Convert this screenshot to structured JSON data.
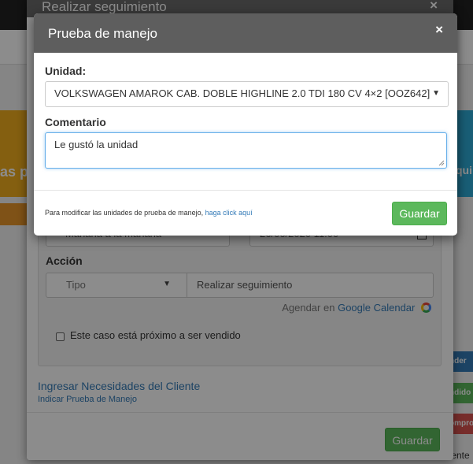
{
  "background": {
    "card_left_text": "as p",
    "card_right_text": "qui",
    "side_buttons": [
      "nder",
      "ndido",
      "ompro"
    ],
    "cliente_text": "liente"
  },
  "modal_seguimiento": {
    "title": "Realizar seguimiento",
    "close": "×",
    "schedule_select": "Mañana a la mañana",
    "schedule_date": "26/06/2020  11:00",
    "accion_label": "Acción",
    "tipo_placeholder": "Tipo",
    "accion_value": "Realizar seguimiento",
    "agendar_prefix": "Agendar en",
    "agendar_link": "Google Calendar",
    "checkbox_label": "Este caso está próximo a ser vendido",
    "link_necesidades": "Ingresar Necesidades del Cliente",
    "link_prueba": "Indicar Prueba de Manejo",
    "guardar": "Guardar"
  },
  "modal_prueba": {
    "title": "Prueba de manejo",
    "close": "×",
    "unidad_label": "Unidad:",
    "unidad_value": "VOLKSWAGEN AMAROK CAB. DOBLE HIGHLINE 2.0 TDI 180 CV 4×2 [OOZ642]",
    "comentario_label": "Comentario",
    "comentario_value": "Le gustó la unidad",
    "footer_text": "Para modificar las unidades de prueba de manejo,",
    "footer_link": "haga click aquí",
    "guardar": "Guardar"
  },
  "colors": {
    "primary_link": "#337ab7",
    "success": "#5cb85c",
    "header_gray": "#5e5e5e"
  }
}
